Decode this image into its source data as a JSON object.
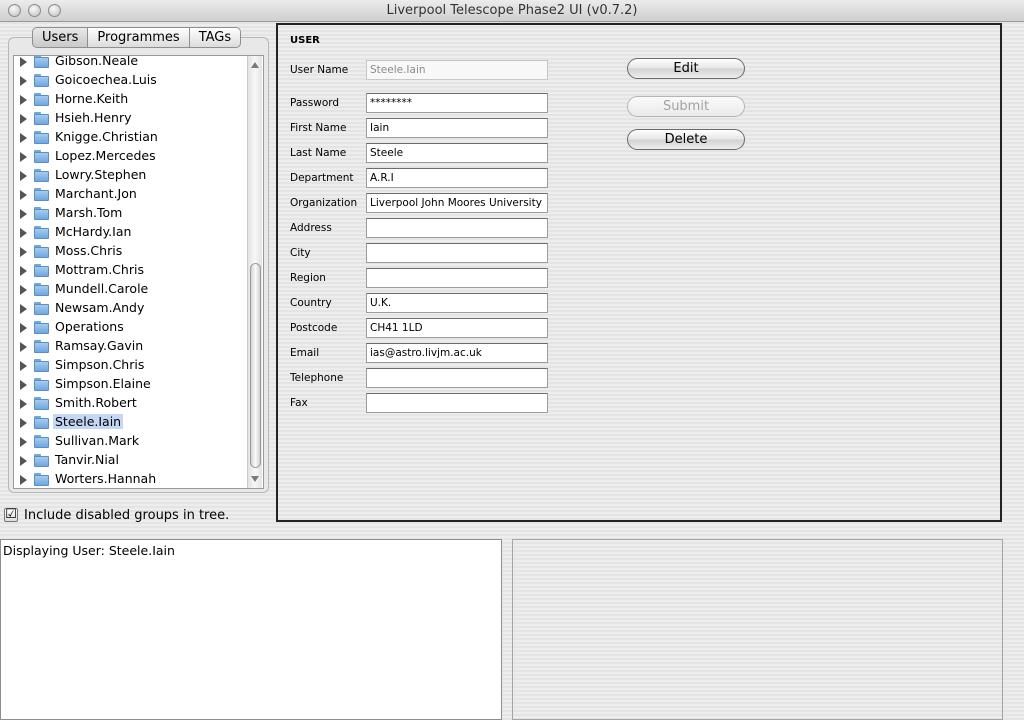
{
  "window": {
    "title": "Liverpool Telescope Phase2 UI (v0.7.2)"
  },
  "tabs": [
    {
      "label": "Users"
    },
    {
      "label": "Programmes"
    },
    {
      "label": "TAGs"
    }
  ],
  "tree": {
    "selected": "Steele.Iain",
    "items": [
      "Gibson.Neale",
      "Goicoechea.Luis",
      "Horne.Keith",
      "Hsieh.Henry",
      "Knigge.Christian",
      "Lopez.Mercedes",
      "Lowry.Stephen",
      "Marchant.Jon",
      "Marsh.Tom",
      "McHardy.Ian",
      "Moss.Chris",
      "Mottram.Chris",
      "Mundell.Carole",
      "Newsam.Andy",
      "Operations",
      "Ramsay.Gavin",
      "Simpson.Chris",
      "Simpson.Elaine",
      "Smith.Robert",
      "Steele.Iain",
      "Sullivan.Mark",
      "Tanvir.Nial",
      "Worters.Hannah"
    ]
  },
  "include_disabled": {
    "label": "Include disabled groups in tree.",
    "checked": true,
    "mark": "☑"
  },
  "user_form": {
    "section_title": "USER",
    "fields": [
      {
        "label": "User Name",
        "value": "Steele.Iain"
      },
      {
        "label": "Password",
        "value": "********"
      },
      {
        "label": "First Name",
        "value": "Iain"
      },
      {
        "label": "Last Name",
        "value": "Steele"
      },
      {
        "label": "Department",
        "value": "A.R.I"
      },
      {
        "label": "Organization",
        "value": "Liverpool John Moores University"
      },
      {
        "label": "Address",
        "value": ""
      },
      {
        "label": "City",
        "value": ""
      },
      {
        "label": "Region",
        "value": ""
      },
      {
        "label": "Country",
        "value": "U.K."
      },
      {
        "label": "Postcode",
        "value": "CH41 1LD"
      },
      {
        "label": "Email",
        "value": "ias@astro.livjm.ac.uk"
      },
      {
        "label": "Telephone",
        "value": ""
      },
      {
        "label": "Fax",
        "value": ""
      }
    ],
    "buttons": {
      "edit": "Edit",
      "submit": "Submit",
      "delete": "Delete"
    }
  },
  "log": {
    "text": "Displaying User: Steele.Iain"
  }
}
